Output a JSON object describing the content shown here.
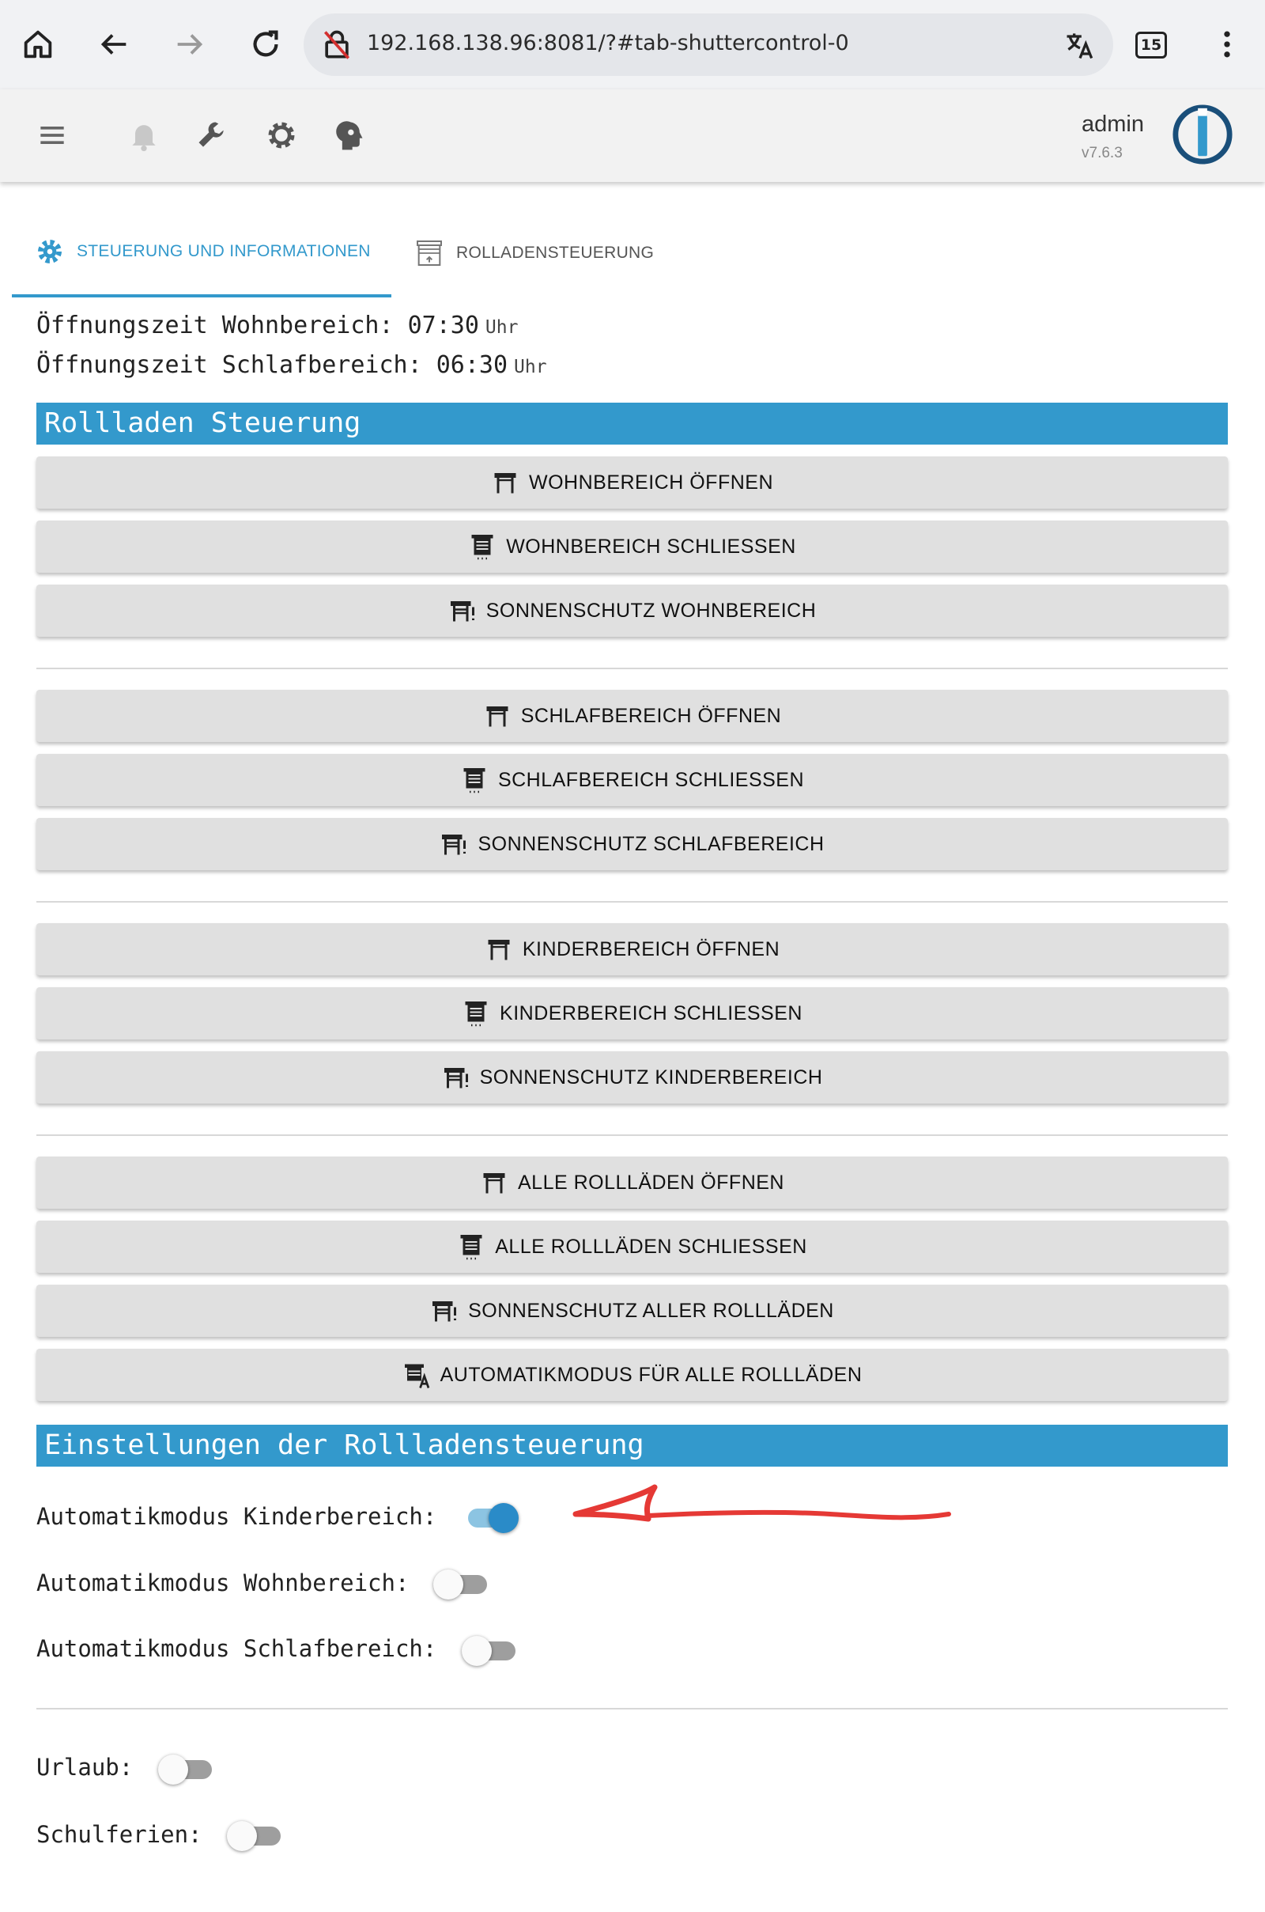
{
  "browser": {
    "url": "192.168.138.96:8081/?#tab-shuttercontrol-0",
    "tab_count": "15"
  },
  "toolbar": {
    "user": "admin",
    "version": "v7.6.3"
  },
  "tabs": [
    {
      "label": "STEUERUNG UND INFORMATIONEN",
      "active": true
    },
    {
      "label": "ROLLADENSTEUERUNG",
      "active": false
    }
  ],
  "info": [
    {
      "text": "Öffnungszeit Wohnbereich: 07:30",
      "unit": "Uhr"
    },
    {
      "text": "Öffnungszeit Schlafbereich: 06:30",
      "unit": "Uhr"
    }
  ],
  "sections": {
    "control": "Rollladen Steuerung",
    "settings": "Einstellungen der Rollladensteuerung"
  },
  "buttons": [
    "WOHNBEREICH ÖFFNEN",
    "WOHNBEREICH SCHLIESSEN",
    "SONNENSCHUTZ WOHNBEREICH",
    "SCHLAFBEREICH ÖFFNEN",
    "SCHLAFBEREICH SCHLIESSEN",
    "SONNENSCHUTZ SCHLAFBEREICH",
    "KINDERBEREICH ÖFFNEN",
    "KINDERBEREICH SCHLIESSEN",
    "SONNENSCHUTZ KINDERBEREICH",
    "ALLE ROLLLÄDEN ÖFFNEN",
    "ALLE ROLLLÄDEN SCHLIESSEN",
    "SONNENSCHUTZ ALLER ROLLLÄDEN",
    "AUTOMATIKMODUS FÜR ALLE ROLLLÄDEN"
  ],
  "settings": [
    {
      "label": "Automatikmodus Kinderbereich:",
      "on": true
    },
    {
      "label": "Automatikmodus Wohnbereich:",
      "on": false
    },
    {
      "label": "Automatikmodus Schlafbereich:",
      "on": false
    },
    {
      "label": "Urlaub:",
      "on": false
    },
    {
      "label": "Schulferien:",
      "on": false
    }
  ],
  "colors": {
    "accent": "#3399cc",
    "annotation": "#e53935"
  }
}
